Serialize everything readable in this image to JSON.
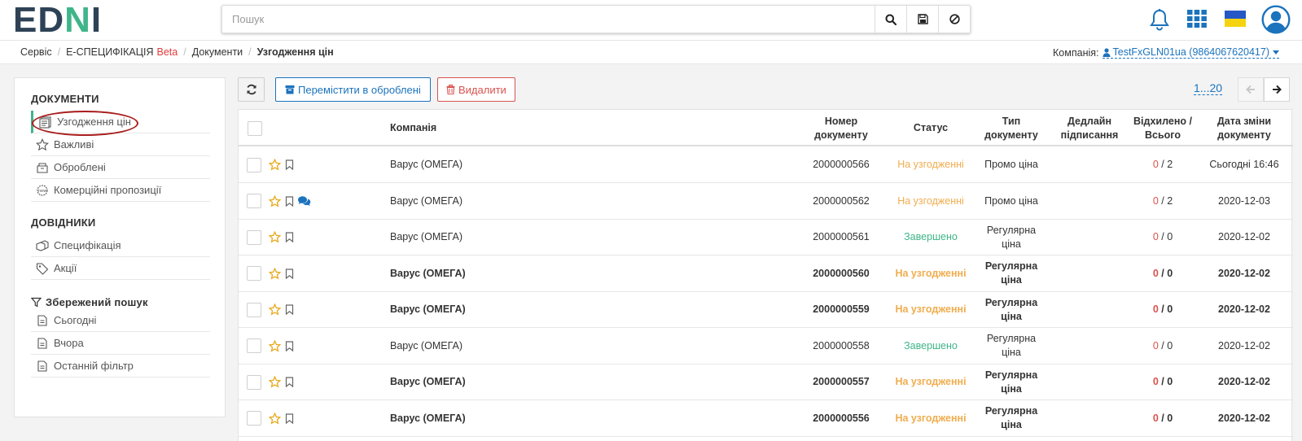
{
  "header": {
    "logo": {
      "left": "ED",
      "right": "I",
      "n": "N"
    },
    "search": {
      "placeholder": "Пошук"
    },
    "icons": [
      "search-icon",
      "save-icon",
      "clear-icon",
      "bell-icon",
      "apps-grid-icon",
      "flag-ua-icon",
      "user-avatar-icon"
    ]
  },
  "breadcrumb": {
    "items": [
      "Сервіс",
      "Е-СПЕЦИФІКАЦІЯ",
      "Документи",
      "Узгодження цін"
    ],
    "beta": "Beta",
    "company_label": "Компанія:",
    "company_value": "TestFxGLN01ua (9864067620417)"
  },
  "sidebar": {
    "documents_title": "ДОКУМЕНТИ",
    "documents": [
      {
        "label": "Узгодження цін",
        "icon": "price-list-icon"
      },
      {
        "label": "Важливі",
        "icon": "star-icon"
      },
      {
        "label": "Оброблені",
        "icon": "archive-icon"
      },
      {
        "label": "Комерційні пропозиції",
        "icon": "offer-icon"
      }
    ],
    "refs_title": "ДОВІДНИКИ",
    "refs": [
      {
        "label": "Специфікація",
        "icon": "boxes-icon"
      },
      {
        "label": "Акції",
        "icon": "tags-icon"
      }
    ],
    "saved_title": "Збережений пошук",
    "saved": [
      {
        "label": "Сьогодні",
        "icon": "file-icon"
      },
      {
        "label": "Вчора",
        "icon": "file-icon"
      },
      {
        "label": "Останній фільтр",
        "icon": "file-icon"
      }
    ]
  },
  "toolbar": {
    "move_label": "Перемістити в оброблені",
    "delete_label": "Видалити",
    "pager": "1...20"
  },
  "table": {
    "headers": {
      "company": "Компанія",
      "doc_number": "Номер документу",
      "status": "Статус",
      "doc_type": "Тип документу",
      "deadline": "Дедлайн підписання",
      "rejected": "Відхилено / Всього",
      "changed": "Дата зміни документу"
    },
    "rows": [
      {
        "company": "Варус (ОМЕГА)",
        "number": "2000000566",
        "status": "На узгодженні",
        "status_kind": "pending",
        "type": "Промо ціна",
        "rejected": "0",
        "total": "2",
        "date": "Сьогодні 16:46",
        "bold": false,
        "chat": false
      },
      {
        "company": "Варус (ОМЕГА)",
        "number": "2000000562",
        "status": "На узгодженні",
        "status_kind": "pending",
        "type": "Промо ціна",
        "rejected": "0",
        "total": "2",
        "date": "2020-12-03",
        "bold": false,
        "chat": true
      },
      {
        "company": "Варус (ОМЕГА)",
        "number": "2000000561",
        "status": "Завершено",
        "status_kind": "done",
        "type": "Регулярна ціна",
        "rejected": "0",
        "total": "0",
        "date": "2020-12-02",
        "bold": false,
        "chat": false
      },
      {
        "company": "Варус (ОМЕГА)",
        "number": "2000000560",
        "status": "На узгодженні",
        "status_kind": "pending",
        "type": "Регулярна ціна",
        "rejected": "0",
        "total": "0",
        "date": "2020-12-02",
        "bold": true,
        "chat": false
      },
      {
        "company": "Варус (ОМЕГА)",
        "number": "2000000559",
        "status": "На узгодженні",
        "status_kind": "pending",
        "type": "Регулярна ціна",
        "rejected": "0",
        "total": "0",
        "date": "2020-12-02",
        "bold": true,
        "chat": false
      },
      {
        "company": "Варус (ОМЕГА)",
        "number": "2000000558",
        "status": "Завершено",
        "status_kind": "done",
        "type": "Регулярна ціна",
        "rejected": "0",
        "total": "0",
        "date": "2020-12-02",
        "bold": false,
        "chat": false
      },
      {
        "company": "Варус (ОМЕГА)",
        "number": "2000000557",
        "status": "На узгодженні",
        "status_kind": "pending",
        "type": "Регулярна ціна",
        "rejected": "0",
        "total": "0",
        "date": "2020-12-02",
        "bold": true,
        "chat": false
      },
      {
        "company": "Варус (ОМЕГА)",
        "number": "2000000556",
        "status": "На узгодженні",
        "status_kind": "pending",
        "type": "Регулярна ціна",
        "rejected": "0",
        "total": "0",
        "date": "2020-12-02",
        "bold": true,
        "chat": false
      }
    ]
  },
  "colors": {
    "accent": "#1b73bd",
    "brand_green": "#3fb58a",
    "pending": "#f0ad4e",
    "danger": "#d9534f",
    "annotation": "#a81c1c"
  }
}
